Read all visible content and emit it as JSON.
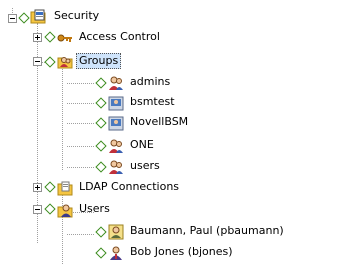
{
  "tree": {
    "security": {
      "label": "Security",
      "icon": "security-folder-icon"
    },
    "access_control": {
      "label": "Access Control",
      "icon": "keys-icon"
    },
    "groups": {
      "label": "Groups",
      "icon": "groups-folder-icon",
      "items": [
        {
          "label": "admins",
          "icon": "group-icon"
        },
        {
          "label": "bsmtest",
          "icon": "computer-group-icon"
        },
        {
          "label": "NovellBSM",
          "icon": "computer-group-icon"
        },
        {
          "label": "ONE",
          "icon": "group-icon"
        },
        {
          "label": "users",
          "icon": "group-icon"
        }
      ]
    },
    "ldap": {
      "label": "LDAP Connections",
      "icon": "ldap-folder-icon"
    },
    "users": {
      "label": "Users",
      "icon": "users-folder-icon",
      "items": [
        {
          "label": "Baumann, Paul (pbaumann)",
          "icon": "user-card-icon"
        },
        {
          "label": "Bob Jones (bjones)",
          "icon": "user-icon"
        }
      ]
    }
  },
  "colors": {
    "selection": "#cfe4fb",
    "diamond": "#3c8c1e",
    "folder": "#f5c542"
  }
}
